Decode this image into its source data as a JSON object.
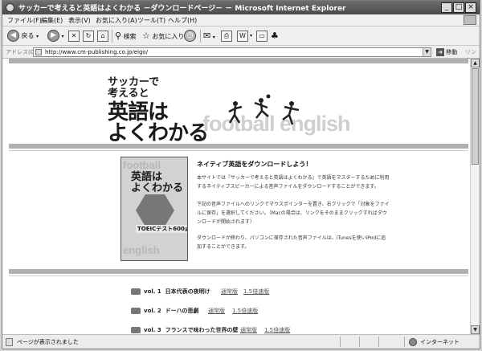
{
  "window": {
    "title": "サッカーで考えると英語はよくわかる －ダウンロードページ－ － Microsoft Internet Explorer",
    "buttons": {
      "minimize": "_",
      "maximize": "□",
      "close": "×"
    }
  },
  "menu": [
    "ファイル(F)",
    "編集(E)",
    "表示(V)",
    "お気に入り(A)",
    "ツール(T)",
    "ヘルプ(H)"
  ],
  "toolbar": {
    "back": "戻る",
    "search": "検索",
    "favorites": "お気に入り"
  },
  "address": {
    "label": "アドレス(D)",
    "url": "http://www.cm-publishing.co.jp/eigo/",
    "go": "移動",
    "links": "リンク"
  },
  "banner": {
    "line1": "サッカーで",
    "line2": "考えると",
    "line3": "英語は",
    "line4": "よくわかる",
    "background_text": "football english"
  },
  "book": {
    "bg_top": "football",
    "title_line1": "英語は",
    "title_line2": "よくわかる",
    "band": "TOEICテスト600点",
    "bg_bottom": "english"
  },
  "intro": {
    "heading": "ネイティブ英語をダウンロードしよう！",
    "paragraph1": "本サイトでは『サッカーで考えると英語はよくわかる』で英語をマスターするために利用するネイティブスピーカーによる音声ファイルをダウンロードすることができます。",
    "paragraph2": "下記の音声ファイルへのリンクでマウスポインターを置き、右クリックで「対象をファイルに保存」を選択してください。（Macの場合は、リンクをそのままクリックすればダウンロードが開始されます）",
    "paragraph3": "ダウンロードが終わり、パソコンに保存された音声ファイルは、iTunesを使いiPodに追加することができます。"
  },
  "downloads": [
    {
      "vol": "vol. 1",
      "title": "日本代表の夜明け",
      "normal": "通常版",
      "fast": "1.5倍速版"
    },
    {
      "vol": "vol. 2",
      "title": "ドーハの悲劇",
      "normal": "通常版",
      "fast": "1.5倍速版"
    },
    {
      "vol": "vol. 3",
      "title": "フランスで味わった世界の壁",
      "normal": "通常版",
      "fast": "1.5倍速版"
    }
  ],
  "status": {
    "text": "ページが表示されました",
    "zone": "インターネット"
  }
}
